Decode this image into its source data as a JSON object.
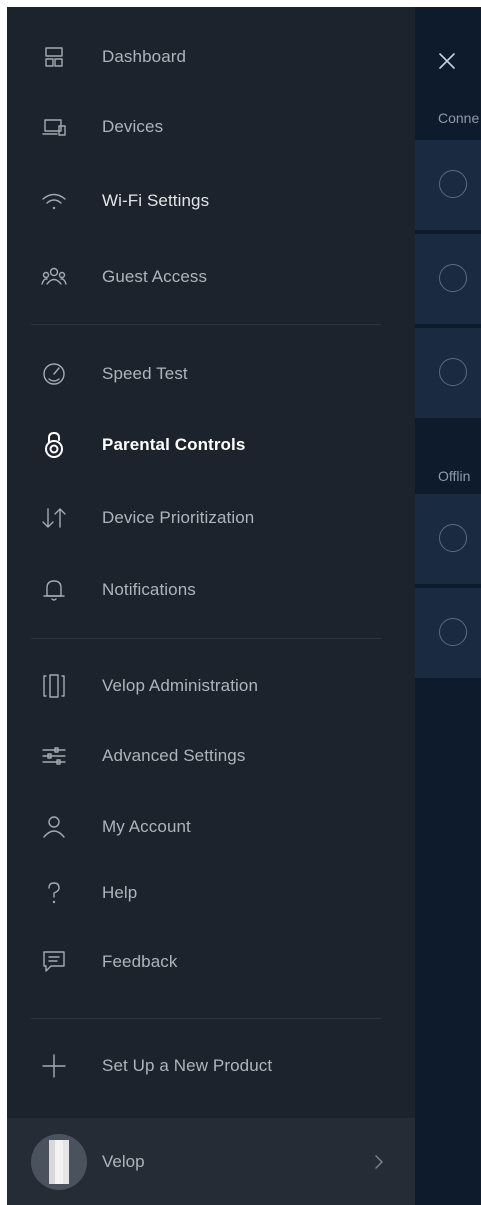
{
  "menu": {
    "items": [
      {
        "label": "Dashboard",
        "icon": "dashboard-icon"
      },
      {
        "label": "Devices",
        "icon": "devices-icon"
      },
      {
        "label": "Wi-Fi Settings",
        "icon": "wifi-icon"
      },
      {
        "label": "Guest Access",
        "icon": "guest-access-icon"
      },
      {
        "label": "Speed Test",
        "icon": "speedometer-icon"
      },
      {
        "label": "Parental Controls",
        "icon": "lock-icon"
      },
      {
        "label": "Device Prioritization",
        "icon": "priority-arrows-icon"
      },
      {
        "label": "Notifications",
        "icon": "bell-icon"
      },
      {
        "label": "Velop Administration",
        "icon": "velop-node-icon"
      },
      {
        "label": "Advanced Settings",
        "icon": "sliders-icon"
      },
      {
        "label": "My Account",
        "icon": "user-icon"
      },
      {
        "label": "Help",
        "icon": "question-icon"
      },
      {
        "label": "Feedback",
        "icon": "chat-bubble-icon"
      },
      {
        "label": "Set Up a New Product",
        "icon": "plus-icon"
      }
    ],
    "active": "Parental Controls"
  },
  "footer": {
    "device_label": "Velop",
    "device_icon": "velop-node-image",
    "chevron_icon": "chevron-right-icon"
  },
  "background_panel": {
    "close_icon": "close-icon",
    "sections": [
      {
        "label": "Conne",
        "row_count": 3
      },
      {
        "label": "Offlin",
        "row_count": 2
      }
    ]
  },
  "colors": {
    "drawer_bg": "#1d232c",
    "drawer_footer_bg": "#262c35",
    "panel_bg": "#0e1b2d",
    "panel_row_bg": "#1a2a40",
    "text_muted": "#aeb4bb",
    "text_active": "#ffffff"
  }
}
